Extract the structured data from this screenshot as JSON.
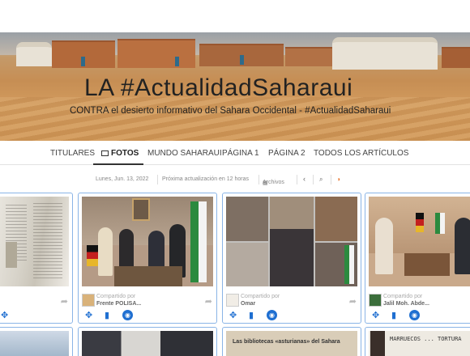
{
  "banner": {
    "title": "LA #ActualidadSaharaui",
    "subtitle": "CONTRA el desierto informativo del Sahara Occidental - #ActualidadSaharaui"
  },
  "nav": {
    "items": [
      {
        "label": "TITULARES"
      },
      {
        "label": "FOTOS",
        "active": true,
        "icon": "image-icon"
      },
      {
        "label": "MUNDO SAHARAUI"
      },
      {
        "label": "PÁGINA 1"
      },
      {
        "label": "PÁGINA 2"
      },
      {
        "label": "TODOS LOS ARTÍCULOS"
      }
    ]
  },
  "meta": {
    "date": "Lunes, Jun. 13, 2022",
    "next_update": "Próxima actualización en 12 horas",
    "archive": "Archivos",
    "icons": [
      "calendar-icon",
      "chevron-left-icon",
      "search-icon",
      "rss-icon"
    ]
  },
  "cards": [
    {
      "shared_by_label": "",
      "sharer": ""
    },
    {
      "shared_by_label": "Compartido por",
      "sharer": "Frente POLISA..."
    },
    {
      "shared_by_label": "Compartido por",
      "sharer": "Omar"
    },
    {
      "shared_by_label": "Compartido por",
      "sharer": "Jalil Moh. Abde..."
    }
  ],
  "bottom_cards": {
    "card3_caption": "Las bibliotecas «asturianas» del Sahara",
    "card4_caption": "MARRUECOS ... TORTURA"
  },
  "colors": {
    "accent_blue": "#1f6fd1",
    "card_border": "#8ab4e6",
    "rss_orange": "#e8742c"
  }
}
